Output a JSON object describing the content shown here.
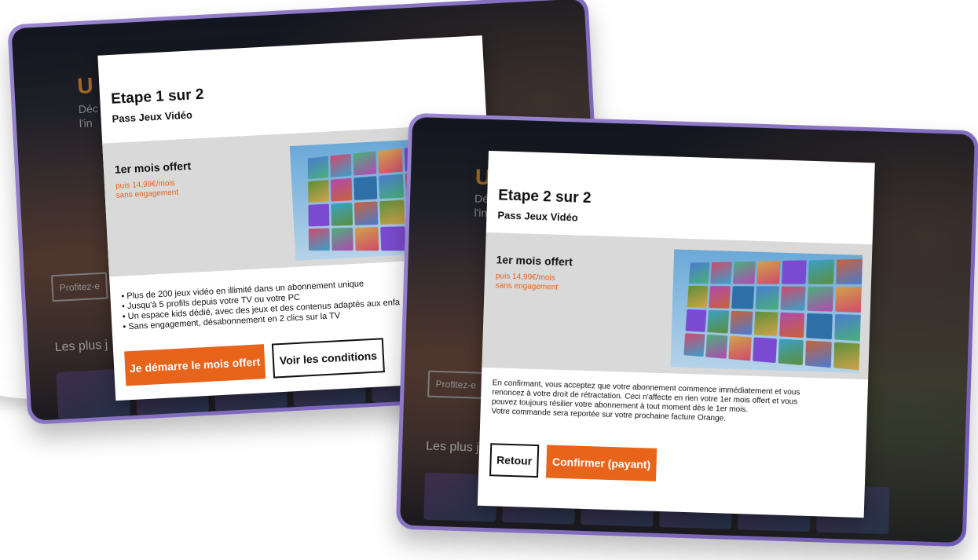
{
  "screen1": {
    "bg_title_fragment": "U",
    "bg_sub_lines": [
      "Déc",
      "l'in"
    ],
    "bg_cta": "Profitez-e",
    "bg_row_title": "Les plus j",
    "modal": {
      "step": "Etape 1 sur 2",
      "product": "Pass Jeux Vidéo",
      "offer_title": "1er mois offert",
      "offer_price_line1": "puis 14,99€/mois",
      "offer_price_line2": "sans engagement",
      "bullets": [
        "Plus de 200 jeux vidéo en illimité dans un abonnement unique",
        "Jusqu'à 5 profils depuis votre TV ou votre PC",
        "Un espace kids dédié, avec des jeux et des contenus adaptés aux enfa",
        "Sans engagement, désabonnement en 2 clics sur la TV"
      ],
      "primary_button": "Je démarre  le mois offert",
      "secondary_button": "Voir les conditions"
    }
  },
  "screen2": {
    "bg_title_fragment": "U",
    "bg_sub_lines": [
      "Déc",
      "l'in"
    ],
    "bg_cta": "Profitez-e",
    "bg_row_title": "Les plus j",
    "modal": {
      "step": "Etape 2 sur 2",
      "product": "Pass Jeux Vidéo",
      "offer_title": "1er mois offert",
      "offer_price_line1": "puis 14,99€/mois",
      "offer_price_line2": "sans engagement",
      "legal_lines": [
        "En confirmant, vous acceptez que votre abonnement commence immédiatement et vous",
        "renoncez à votre droit de rétractation. Ceci n'affecte en rien votre 1er mois offert et vous",
        "pouvez toujours résilier votre abonnement à tout moment dès le 1er mois.",
        "Votre commande sera reportée sur votre prochaine facture Orange."
      ],
      "back_button": "Retour",
      "confirm_button": "Confirmer (payant)"
    }
  },
  "colors": {
    "accent_orange": "#e8641b",
    "tv_frame": "#7a64bd"
  }
}
